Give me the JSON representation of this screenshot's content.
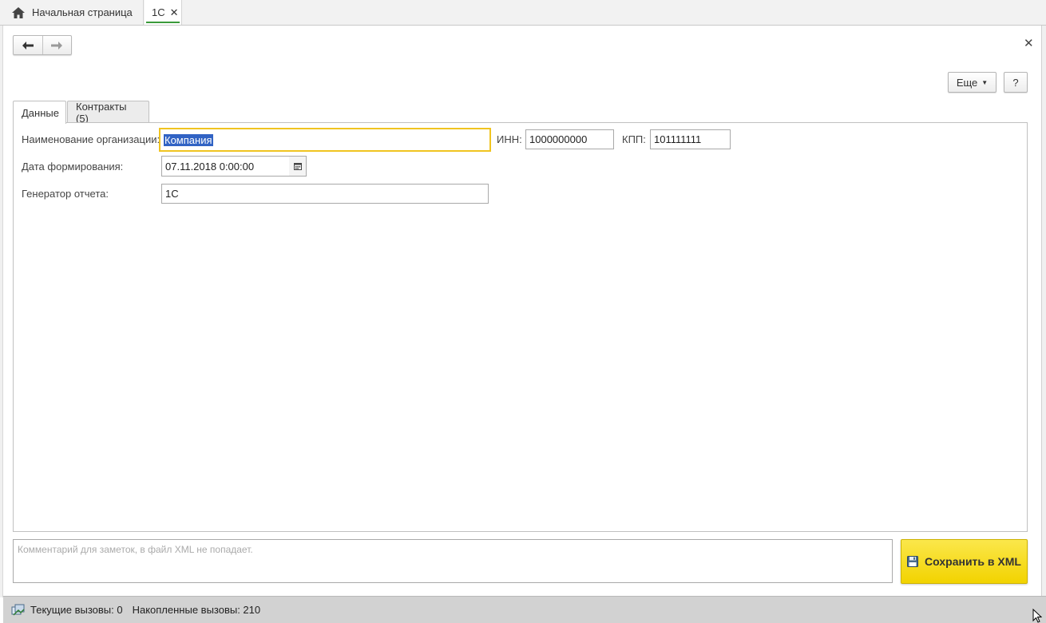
{
  "tabs_bar": {
    "home_label": "Начальная страница",
    "active_label": "1С"
  },
  "toolbar": {
    "more_label": "Еще",
    "help_label": "?"
  },
  "form_tabs": {
    "data_label": "Данные",
    "contracts_label": "Контракты (5)"
  },
  "form": {
    "org_name_label": "Наименование организации:",
    "org_name_value": "Компания",
    "inn_label": "ИНН:",
    "inn_value": "1000000000",
    "kpp_label": "КПП:",
    "kpp_value": "101111111",
    "date_label": "Дата формирования:",
    "date_value": "07.11.2018  0:00:00",
    "generator_label": "Генератор отчета:",
    "generator_value": "1С"
  },
  "bottom": {
    "comment_placeholder": "Комментарий для заметок, в файл XML не попадает.",
    "save_label": "Сохранить в XML"
  },
  "status": {
    "current_calls": "Текущие вызовы: 0",
    "accumulated_calls": "Накопленные вызовы: 210"
  },
  "colors": {
    "accent_green": "#3a9a3a",
    "focus_yellow": "#f0c420",
    "save_button_yellow": "#f2d300",
    "selection_blue": "#3163c4"
  },
  "icons": {
    "home": "home-icon",
    "back": "arrow-left-icon",
    "forward": "arrow-right-icon",
    "close": "close-icon",
    "calendar": "calendar-icon",
    "save": "floppy-disk-icon",
    "status": "performance-icon"
  }
}
